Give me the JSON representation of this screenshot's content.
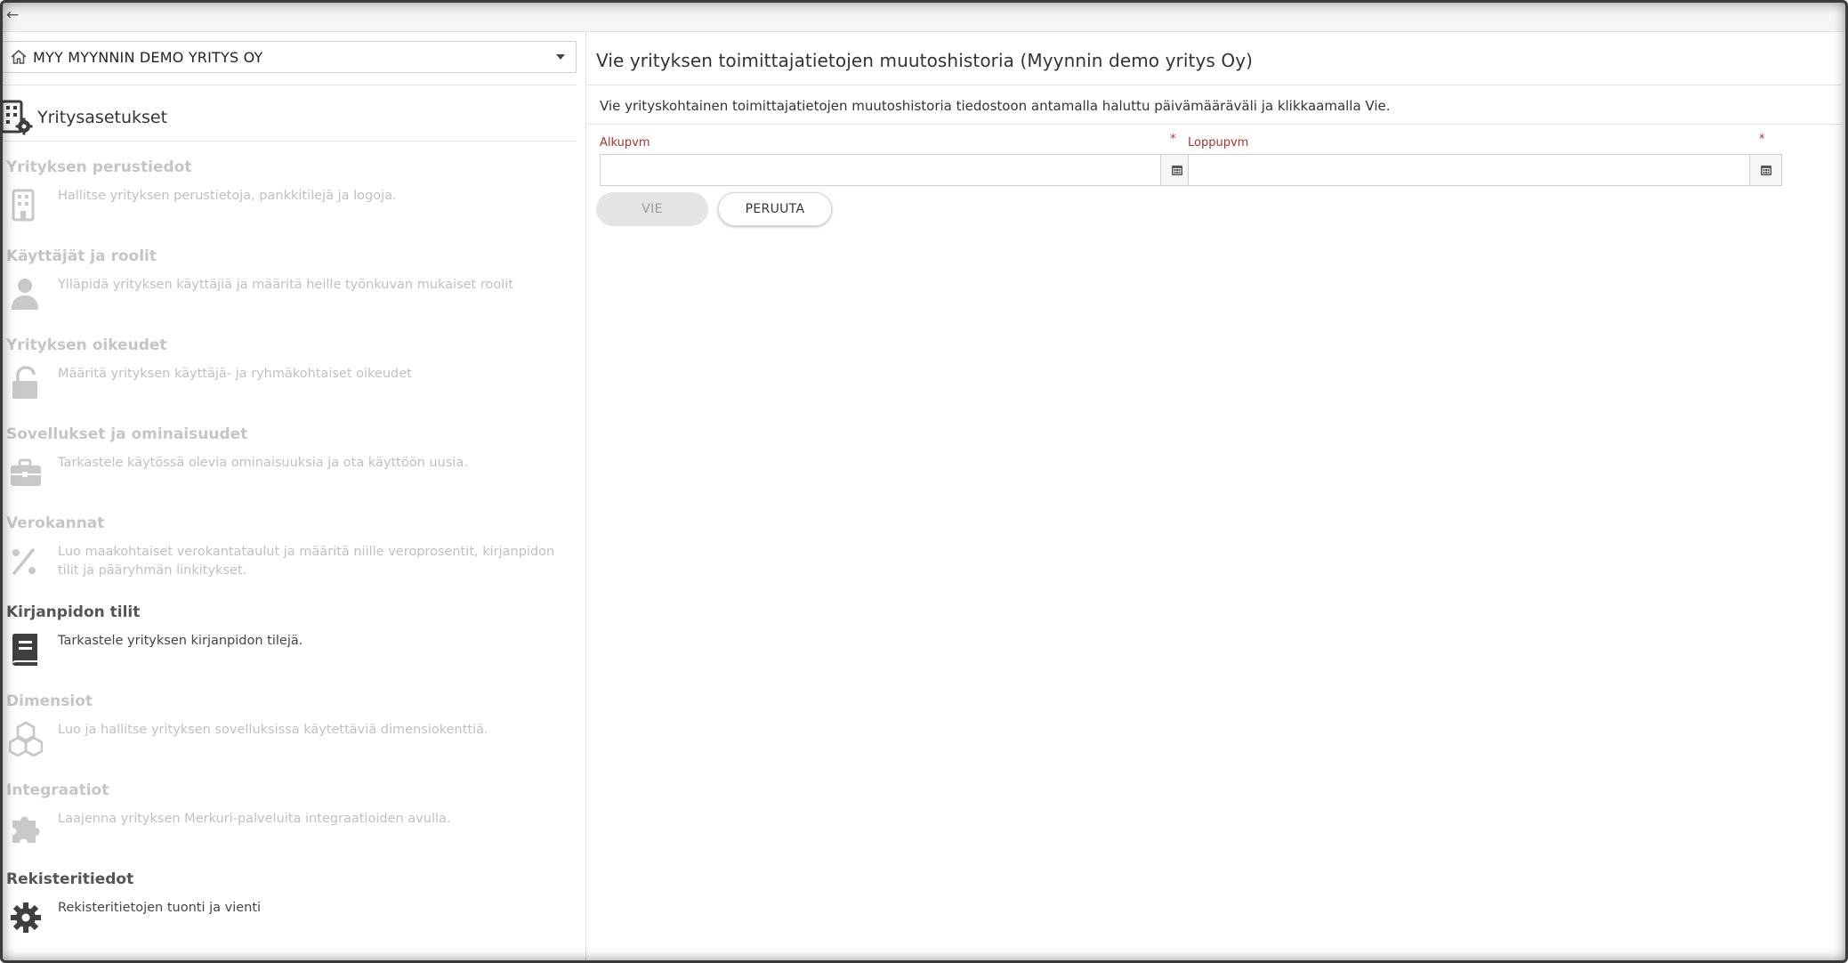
{
  "topbar": {
    "back_icon": "arrow-left-icon"
  },
  "company_select": {
    "value": "MYY MYYNNIN DEMO YRITYS OY",
    "icon": "home-icon"
  },
  "settings": {
    "title": "Yritysasetukset",
    "icon": "building-gear-icon",
    "sections": [
      {
        "title": "Yrityksen perustiedot",
        "desc": "Hallitse yrityksen perustietoja, pankkitilejä ja logoja.",
        "icon": "building-icon",
        "active": false
      },
      {
        "title": "Käyttäjät ja roolit",
        "desc": "Ylläpidä yrityksen käyttäjiä ja määritä heille työnkuvan mukaiset roolit",
        "icon": "user-icon",
        "active": false
      },
      {
        "title": "Yrityksen oikeudet",
        "desc": "Määritä yrityksen käyttäjä- ja ryhmäkohtaiset oikeudet",
        "icon": "unlock-icon",
        "active": false
      },
      {
        "title": "Sovellukset ja ominaisuudet",
        "desc": "Tarkastele käytössä olevia ominaisuuksia ja ota käyttöön uusia.",
        "icon": "briefcase-icon",
        "active": false
      },
      {
        "title": "Verokannat",
        "desc": "Luo maakohtaiset verokantataulut ja määritä niille veroprosentit, kirjanpidon tilit ja pääryhmän linkitykset.",
        "icon": "percent-icon",
        "active": false
      },
      {
        "title": "Kirjanpidon tilit",
        "desc": "Tarkastele yrityksen kirjanpidon tilejä.",
        "icon": "book-icon",
        "active": true
      },
      {
        "title": "Dimensiot",
        "desc": "Luo ja hallitse yrityksen sovelluksissa käytettäviä dimensiokenttiä.",
        "icon": "cubes-icon",
        "active": false
      },
      {
        "title": "Integraatiot",
        "desc": "Laajenna yrityksen Merkuri-palveluita integraatioiden avulla.",
        "icon": "puzzle-icon",
        "active": false
      },
      {
        "title": "Rekisteritiedot",
        "desc": "Rekisteritietojen tuonti ja vienti",
        "icon": "gear-icon",
        "active": true
      }
    ]
  },
  "main": {
    "title": "Vie yrityksen toimittajatietojen muutoshistoria (Myynnin demo yritys Oy)",
    "instructions": "Vie yrityskohtainen toimittajatietojen muutoshistoria tiedostoon antamalla haluttu päivämääräväli ja klikkaamalla Vie.",
    "start_label": "Alkupvm",
    "end_label": "Loppupvm",
    "required_mark": "*",
    "start_value": "",
    "end_value": "",
    "export_label": "VIE",
    "cancel_label": "PERUUTA",
    "calendar_icon": "calendar-icon"
  }
}
